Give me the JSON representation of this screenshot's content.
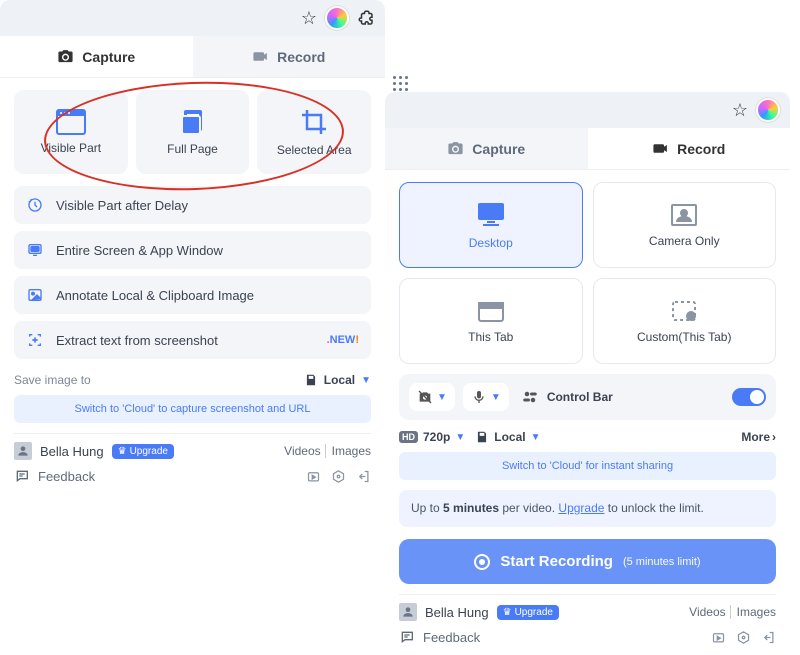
{
  "left": {
    "tabs": {
      "capture": "Capture",
      "record": "Record"
    },
    "tiles": {
      "visible": "Visible Part",
      "full": "Full Page",
      "selected": "Selected Area"
    },
    "items": {
      "delay": "Visible Part after Delay",
      "screen": "Entire Screen & App Window",
      "annotate": "Annotate Local & Clipboard Image",
      "extract": "Extract text from screenshot",
      "extract_new": "NEW"
    },
    "save_label": "Save image to",
    "save_target": "Local",
    "cloud_hint": "Switch to 'Cloud' to capture screenshot and URL",
    "user": "Bella Hung",
    "upgrade": "Upgrade",
    "videos": "Videos",
    "images": "Images",
    "feedback": "Feedback"
  },
  "right": {
    "tabs": {
      "capture": "Capture",
      "record": "Record"
    },
    "tiles": {
      "desktop": "Desktop",
      "camera": "Camera Only",
      "thistab": "This Tab",
      "custom": "Custom(This Tab)"
    },
    "controlbar_label": "Control Bar",
    "resolution": "720p",
    "storage": "Local",
    "more": "More",
    "cloud_hint": "Switch to 'Cloud' for instant sharing",
    "info_pre": "Up to ",
    "info_bold": "5 minutes",
    "info_mid": " per video. ",
    "info_link": "Upgrade",
    "info_post": " to unlock the limit.",
    "start": "Start Recording",
    "start_sub": "(5 minutes limit)",
    "user": "Bella Hung",
    "upgrade": "Upgrade",
    "videos": "Videos",
    "images": "Images",
    "feedback": "Feedback"
  }
}
